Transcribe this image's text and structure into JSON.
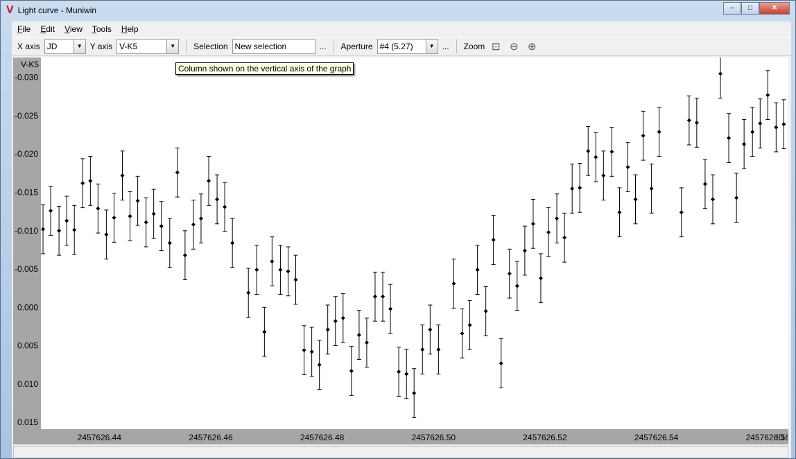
{
  "window": {
    "title": "Light curve - Muniwin",
    "logo": "V",
    "minimize": "–",
    "maximize": "□",
    "close": "✕"
  },
  "menu": [
    "File",
    "Edit",
    "View",
    "Tools",
    "Help"
  ],
  "toolbar": {
    "x_axis_label": "X axis",
    "x_axis_value": "JD",
    "y_axis_label": "Y axis",
    "y_axis_value": "V-K5",
    "selection_label": "Selection",
    "selection_value": "New selection",
    "more": "...",
    "aperture_label": "Aperture",
    "aperture_value": "#4 (5.27)",
    "zoom_label": "Zoom",
    "icons": [
      "zoom-fit-icon",
      "zoom-out-icon",
      "zoom-in-icon"
    ]
  },
  "tooltip": "Column shown on the vertical axis of the graph",
  "chart_data": {
    "type": "scatter",
    "ylabel": "V-K5",
    "xlabel": "JD",
    "y_inverted": true,
    "xlim": [
      2457626.4295,
      2457626.5637
    ],
    "ylim": [
      -0.0326,
      0.0159
    ],
    "xticks": [
      "2457626.44",
      "2457626.46",
      "2457626.48",
      "2457626.50",
      "2457626.52",
      "2457626.54",
      "2457626.56"
    ],
    "xtick_values": [
      2457626.44,
      2457626.46,
      2457626.48,
      2457626.5,
      2457626.52,
      2457626.54,
      2457626.56
    ],
    "yticks": [
      "-0.030",
      "-0.025",
      "-0.020",
      "-0.015",
      "-0.010",
      "-0.005",
      "0.000",
      "0.005",
      "0.010",
      "0.015"
    ],
    "ytick_values": [
      -0.03,
      -0.025,
      -0.02,
      -0.015,
      -0.01,
      -0.005,
      0,
      0.005,
      0.01,
      0.015
    ],
    "yerr": 0.0032,
    "x": [
      2457626.42988,
      2457626.43125,
      2457626.43275,
      2457626.43413,
      2457626.4355,
      2457626.437,
      2457626.43838,
      2457626.43975,
      2457626.44125,
      2457626.44263,
      2457626.44413,
      2457626.4455,
      2457626.44688,
      2457626.44838,
      2457626.44975,
      2457626.45113,
      2457626.45263,
      2457626.454,
      2457626.45538,
      2457626.45688,
      2457626.45825,
      2457626.45963,
      2457626.46113,
      2457626.4625,
      2457626.46388,
      2457626.46675,
      2457626.46825,
      2457626.46963,
      2457626.471,
      2457626.4725,
      2457626.47388,
      2457626.47525,
      2457626.47675,
      2457626.47813,
      2457626.4795,
      2457626.481,
      2457626.48238,
      2457626.48375,
      2457626.48525,
      2457626.48663,
      2457626.488,
      2457626.4895,
      2457626.49088,
      2457626.49225,
      2457626.49375,
      2457626.49513,
      2457626.4965,
      2457626.498,
      2457626.49938,
      2457626.50088,
      2457626.50363,
      2457626.50513,
      2457626.5065,
      2457626.50788,
      2457626.50938,
      2457626.51075,
      2457626.51213,
      2457626.51363,
      2457626.515,
      2457626.51638,
      2457626.51788,
      2457626.51925,
      2457626.52063,
      2457626.52213,
      2457626.5235,
      2457626.52488,
      2457626.52625,
      2457626.52775,
      2457626.52913,
      2457626.5305,
      2457626.532,
      2457626.53338,
      2457626.53488,
      2457626.53625,
      2457626.53763,
      2457626.53913,
      2457626.5405,
      2457626.5445,
      2457626.54588,
      2457626.54725,
      2457626.54875,
      2457626.55013,
      2457626.5515,
      2457626.553,
      2457626.55438,
      2457626.55575,
      2457626.55725,
      2457626.55863,
      2457626.56,
      2457626.5615,
      2457626.56288
    ],
    "y": [
      -0.0102,
      -0.0126,
      -0.01,
      -0.0113,
      -0.0101,
      -0.0162,
      -0.0165,
      -0.0129,
      -0.0095,
      -0.0117,
      -0.0172,
      -0.0119,
      -0.0139,
      -0.0111,
      -0.0122,
      -0.0106,
      -0.0084,
      -0.0176,
      -0.0068,
      -0.0108,
      -0.0116,
      -0.0165,
      -0.0141,
      -0.0131,
      -0.0084,
      -0.0019,
      -0.0049,
      0.0032,
      -0.006,
      -0.0049,
      -0.0047,
      -0.0036,
      0.0056,
      0.0058,
      0.0075,
      0.0029,
      0.0018,
      0.0014,
      0.0083,
      0.0036,
      0.0046,
      -0.0014,
      -0.0014,
      0.0002,
      0.0084,
      0.0087,
      0.0112,
      0.0055,
      0.0029,
      0.0055,
      -0.0031,
      0.0034,
      0.0023,
      -0.0049,
      0.0005,
      -0.0088,
      0.0073,
      -0.0044,
      -0.0028,
      -0.0074,
      -0.0109,
      -0.0038,
      -0.0098,
      -0.0116,
      -0.0091,
      -0.0155,
      -0.0156,
      -0.0204,
      -0.0196,
      -0.0172,
      -0.0203,
      -0.0124,
      -0.0183,
      -0.0141,
      -0.0224,
      -0.0155,
      -0.0229,
      -0.0124,
      -0.0244,
      -0.0241,
      -0.0161,
      -0.0141,
      -0.0305,
      -0.0221,
      -0.0143,
      -0.0213,
      -0.0229,
      -0.024,
      -0.0277,
      -0.0235,
      -0.0239
    ]
  }
}
